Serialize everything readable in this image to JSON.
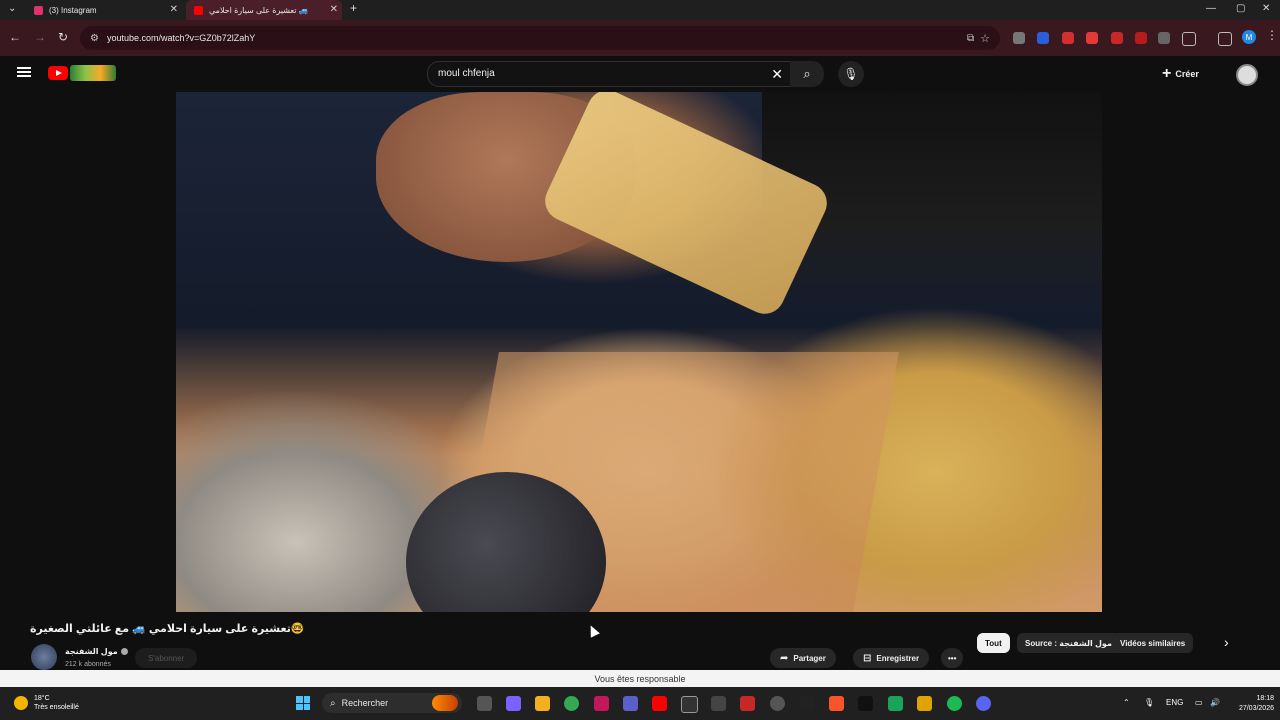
{
  "browser": {
    "tabs": [
      {
        "title": "(3) Instagram",
        "active": false,
        "favicon_color": "#e1306c"
      },
      {
        "title": "تعشيرة على سيارة احلامي 🚙",
        "active": true,
        "favicon_color": "#ff0000"
      }
    ],
    "url": "youtube.com/watch?v=GZ0b72lZahY",
    "profile_initial": "M",
    "extension_badges": [
      "20",
      "1",
      "1"
    ]
  },
  "youtube": {
    "search_query": "moul chfenja",
    "create_label": "Créer",
    "video": {
      "title": "🤓تعشيرة على سيارة احلامي 🚙 مع عائلتي الصغيرة",
      "channel_name": "مول الشفنجة",
      "subscribers": "212 k abonnés",
      "subscribe_label": "S'abonner",
      "share_label": "Partager",
      "save_label": "Enregistrer"
    },
    "chips": [
      {
        "label": "Tout",
        "selected": true
      },
      {
        "label": "Source : مول الشفنجة",
        "selected": false
      },
      {
        "label": "Vidéos similaires",
        "selected": false
      }
    ]
  },
  "banner_text": "Vous êtes responsable",
  "taskbar": {
    "weather_temp": "18°C",
    "weather_desc": "Très ensoleillé",
    "search_label": "Rechercher",
    "language": "ENG",
    "time": "18:18",
    "date": "27/03/2026"
  }
}
